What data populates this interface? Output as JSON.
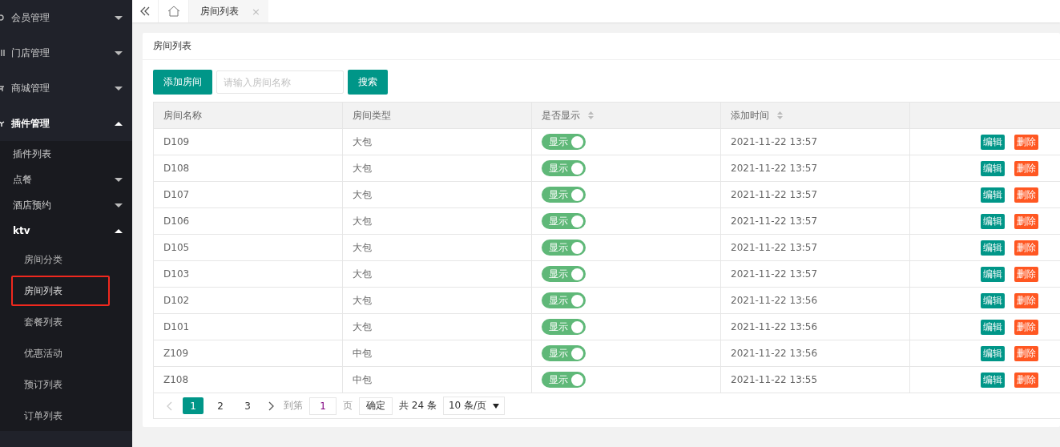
{
  "sidebar": {
    "items": [
      {
        "label": "会员管理",
        "expanded": false
      },
      {
        "label": "门店管理",
        "expanded": false
      },
      {
        "label": "商城管理",
        "expanded": false
      },
      {
        "label": "插件管理",
        "expanded": true,
        "children": [
          {
            "label": "插件列表",
            "selected": false
          },
          {
            "label": "点餐",
            "expanded": false
          },
          {
            "label": "酒店预约",
            "expanded": false
          },
          {
            "label": "ktv",
            "expanded": true,
            "children": [
              {
                "label": "房间分类",
                "selected": false
              },
              {
                "label": "房间列表",
                "selected": true
              },
              {
                "label": "套餐列表",
                "selected": false
              },
              {
                "label": "优惠活动",
                "selected": false
              },
              {
                "label": "预订列表",
                "selected": false
              },
              {
                "label": "订单列表",
                "selected": false
              }
            ]
          }
        ]
      }
    ]
  },
  "tabs": [
    {
      "label": "房间列表",
      "selected": true,
      "close": "×"
    }
  ],
  "card": {
    "title": "房间列表"
  },
  "toolbar": {
    "add_button": "添加房间",
    "search": {
      "placeholder": "请输入房间名称"
    },
    "search_button": "搜索"
  },
  "table": {
    "columns": [
      {
        "label": "房间名称",
        "sortable": false
      },
      {
        "label": "房间类型",
        "sortable": false
      },
      {
        "label": "是否显示",
        "sortable": true
      },
      {
        "label": "添加时间",
        "sortable": true
      },
      {
        "sortable": false
      }
    ],
    "rows": [
      {
        "name": "D109",
        "type": "大包",
        "show": {
          "label": "显示",
          "on": true
        },
        "time": "2021-11-22 13:57",
        "edit": "编辑",
        "delete": "删除"
      },
      {
        "name": "D108",
        "type": "大包",
        "show": {
          "label": "显示",
          "on": true
        },
        "time": "2021-11-22 13:57",
        "edit": "编辑",
        "delete": "删除"
      },
      {
        "name": "D107",
        "type": "大包",
        "show": {
          "label": "显示",
          "on": true
        },
        "time": "2021-11-22 13:57",
        "edit": "编辑",
        "delete": "删除"
      },
      {
        "name": "D106",
        "type": "大包",
        "show": {
          "label": "显示",
          "on": true
        },
        "time": "2021-11-22 13:57",
        "edit": "编辑",
        "delete": "删除"
      },
      {
        "name": "D105",
        "type": "大包",
        "show": {
          "label": "显示",
          "on": true
        },
        "time": "2021-11-22 13:57",
        "edit": "编辑",
        "delete": "删除"
      },
      {
        "name": "D103",
        "type": "大包",
        "show": {
          "label": "显示",
          "on": true
        },
        "time": "2021-11-22 13:57",
        "edit": "编辑",
        "delete": "删除"
      },
      {
        "name": "D102",
        "type": "大包",
        "show": {
          "label": "显示",
          "on": true
        },
        "time": "2021-11-22 13:56",
        "edit": "编辑",
        "delete": "删除"
      },
      {
        "name": "D101",
        "type": "大包",
        "show": {
          "label": "显示",
          "on": true
        },
        "time": "2021-11-22 13:56",
        "edit": "编辑",
        "delete": "删除"
      },
      {
        "name": "Z109",
        "type": "中包",
        "show": {
          "label": "显示",
          "on": true
        },
        "time": "2021-11-22 13:56",
        "edit": "编辑",
        "delete": "删除"
      },
      {
        "name": "Z108",
        "type": "中包",
        "show": {
          "label": "显示",
          "on": true
        },
        "time": "2021-11-22 13:55",
        "edit": "编辑",
        "delete": "删除"
      }
    ]
  },
  "pagination": {
    "pages": [
      {
        "label": "1",
        "selected": true
      },
      {
        "label": "2",
        "selected": false
      },
      {
        "label": "3",
        "selected": false
      }
    ],
    "goto_label": "到第",
    "page_input": "1",
    "page_suffix": "页",
    "confirm": "确定",
    "total": "共 24 条",
    "page_size": "10 条/页"
  }
}
